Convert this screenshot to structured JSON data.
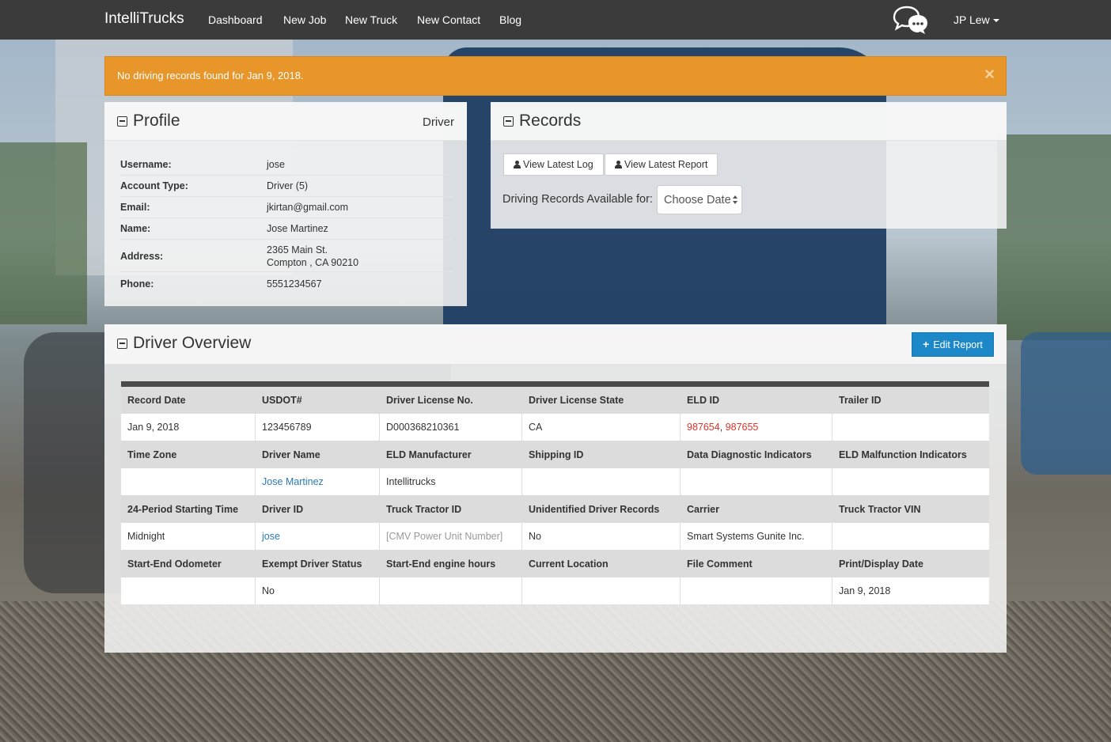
{
  "navbar": {
    "brand": "IntelliTrucks",
    "links": [
      "Dashboard",
      "New Job",
      "New Truck",
      "New Contact",
      "Blog"
    ],
    "user": "JP Lew"
  },
  "alert": {
    "message": "No driving records found for Jan 9, 2018.",
    "close": "×"
  },
  "profile": {
    "title": "Profile",
    "role": "Driver",
    "rows": [
      {
        "label": "Username:",
        "value": "jose"
      },
      {
        "label": "Account Type:",
        "value": "Driver (5)"
      },
      {
        "label": "Email:",
        "value": "jkirtan@gmail.com"
      },
      {
        "label": "Name:",
        "value": "Jose Martinez"
      },
      {
        "label": "Address:",
        "value_line1": "2365 Main St.",
        "value_line2": "Compton , CA 90210"
      },
      {
        "label": "Phone:",
        "value": "5551234567"
      }
    ]
  },
  "records": {
    "title": "Records",
    "view_log": "View Latest Log",
    "view_report": "View Latest Report",
    "available_label": "Driving Records Available for:",
    "select_value": "Choose Date"
  },
  "overview": {
    "title": "Driver Overview",
    "edit_button": "Edit Report",
    "sections": [
      {
        "headers": [
          "Record Date",
          "USDOT#",
          "Driver License No.",
          "Driver License State",
          "ELD ID",
          "Trailer ID"
        ],
        "values": [
          "Jan 9, 2018",
          "123456789",
          "D000368210361",
          "CA",
          "",
          ""
        ]
      },
      {
        "headers": [
          "Time Zone",
          "Driver Name",
          "ELD Manufacturer",
          "Shipping ID",
          "Data Diagnostic Indicators",
          "ELD Malfunction Indicators"
        ],
        "values": [
          "",
          "Jose Martinez",
          "Intellitrucks",
          "",
          "",
          ""
        ]
      },
      {
        "headers": [
          "24-Period Starting Time",
          "Driver ID",
          "Truck Tractor ID",
          "Unidentified Driver Records",
          "Carrier",
          "Truck Tractor VIN"
        ],
        "values": [
          "Midnight",
          "jose",
          "[CMV Power Unit Number]",
          "No",
          "Smart Systems Gunite Inc.",
          ""
        ]
      },
      {
        "headers": [
          "Start-End Odometer",
          "Exempt Driver Status",
          "Start-End engine hours",
          "Current Location",
          "File Comment",
          "Print/Display Date"
        ],
        "values": [
          "",
          "No",
          "",
          "",
          "",
          "Jan 9, 2018"
        ]
      }
    ],
    "eld_ids": [
      "987654",
      "987655"
    ],
    "eld_separator": ", "
  },
  "colors": {
    "navbar": "#3b3b3b",
    "alert": "#e8952a",
    "primary_button": "#1c88c7",
    "link": "#2a7ab7",
    "eld_id": "#d9352a"
  }
}
